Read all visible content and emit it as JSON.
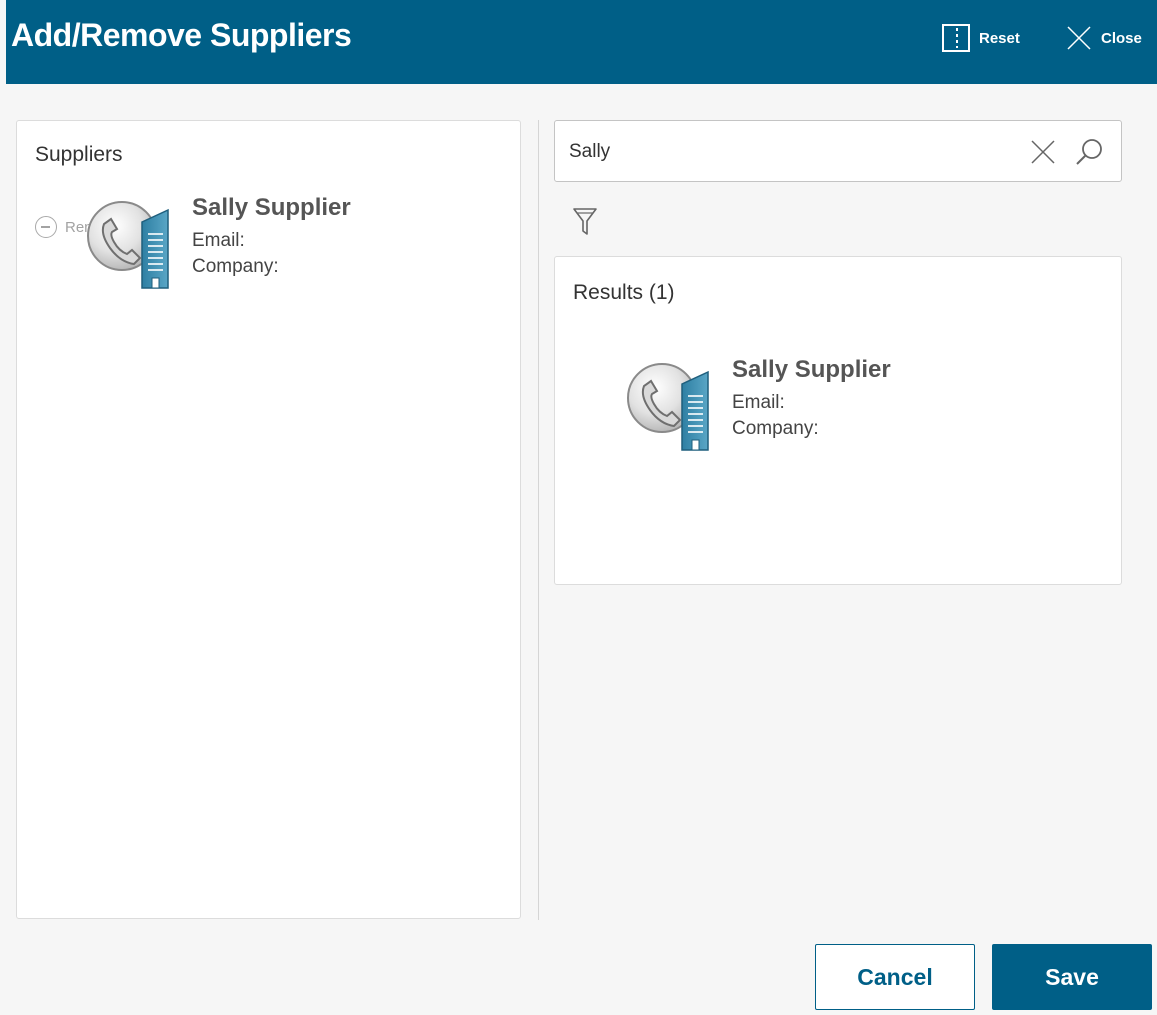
{
  "header": {
    "title": "Add/Remove Suppliers",
    "reset_label": "Reset",
    "close_label": "Close"
  },
  "left_panel": {
    "title": "Suppliers",
    "remove_label": "Remove",
    "items": [
      {
        "name": "Sally Supplier",
        "email_label": "Email:",
        "company_label": "Company:",
        "icon": "supplier-icon"
      }
    ]
  },
  "search": {
    "value": "Sally",
    "clear_icon": "close-icon",
    "search_icon": "search-icon",
    "filter_icon": "filter-icon"
  },
  "results_panel": {
    "title": "Results (1)",
    "items": [
      {
        "name": "Sally Supplier",
        "email_label": "Email:",
        "company_label": "Company:",
        "icon": "supplier-icon"
      }
    ]
  },
  "footer": {
    "cancel_label": "Cancel",
    "save_label": "Save"
  },
  "colors": {
    "brand": "#005f87",
    "background": "#f6f6f6",
    "panel": "#ffffff"
  }
}
